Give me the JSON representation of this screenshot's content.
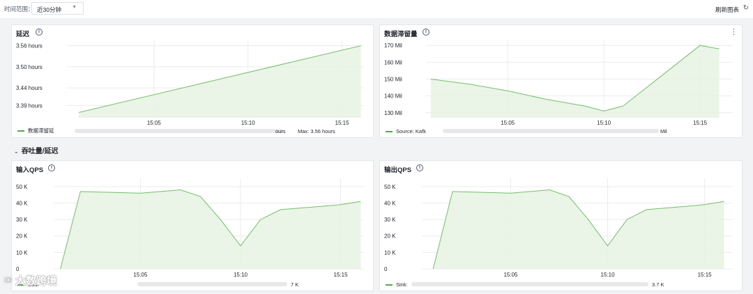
{
  "toolbar": {
    "time_range_label": "时间范围：",
    "time_range_value": "近30分钟",
    "refresh_label": "刷新图表",
    "refresh_icon": "refresh-icon"
  },
  "section": {
    "title": "吞吐量/延迟"
  },
  "logo": {
    "text": "大数跨境"
  },
  "colors": {
    "series": "#73bf69",
    "area": "#e6f2e3"
  },
  "panels": {
    "latency": {
      "title": "延迟",
      "legend_name": "数据滞留延",
      "legend_extra": "Max: 3.56 hours",
      "legend_extra2": "ours"
    },
    "backlog": {
      "title": "数据滞留量",
      "legend_name": "Source: Kafk",
      "legend_extra": "Mil"
    },
    "input_qps": {
      "title": "输入QPS",
      "legend_name": "Sour",
      "legend_extra": "7 K"
    },
    "output_qps": {
      "title": "输出QPS",
      "legend_name": "Sink:",
      "legend_extra": "3.7 K"
    }
  },
  "chart_data": [
    {
      "type": "area",
      "title": "延迟",
      "x_ticks": [
        "15:05",
        "15:10",
        "15:15"
      ],
      "y_ticks": [
        "3.39 hours",
        "3.44 hours",
        "3.50 hours",
        "3.56 hours"
      ],
      "x": [
        "15:01",
        "15:16"
      ],
      "series": [
        {
          "name": "数据滞留延",
          "values": [
            3.37,
            3.56
          ]
        }
      ]
    },
    {
      "type": "area",
      "title": "数据滞留量",
      "x_ticks": [
        "15:05",
        "15:10",
        "15:15"
      ],
      "y_ticks": [
        "130 Mil",
        "140 Mil",
        "150 Mil",
        "160 Mil",
        "170 Mil"
      ],
      "x": [
        "15:01",
        "15:03",
        "15:05",
        "15:07",
        "15:09",
        "15:10",
        "15:11",
        "15:13",
        "15:15",
        "15:16"
      ],
      "series": [
        {
          "name": "Source: Kafk",
          "values": [
            150,
            147,
            143,
            138,
            134,
            131,
            134,
            152,
            170,
            168
          ]
        }
      ]
    },
    {
      "type": "area",
      "title": "输入QPS",
      "x_ticks": [
        "15:05",
        "15:10",
        "15:15"
      ],
      "y_ticks": [
        "0",
        "10 K",
        "20 K",
        "30 K",
        "40 K",
        "50 K"
      ],
      "x": [
        "15:01",
        "15:02",
        "15:05",
        "15:07",
        "15:08",
        "15:09",
        "15:10",
        "15:11",
        "15:12",
        "15:14",
        "15:15",
        "15:16"
      ],
      "series": [
        {
          "name": "Sour",
          "values": [
            0,
            47,
            46,
            48,
            44,
            30,
            14,
            30,
            36,
            38,
            39,
            41
          ]
        }
      ]
    },
    {
      "type": "area",
      "title": "输出QPS",
      "x_ticks": [
        "15:05",
        "15:10",
        "15:15"
      ],
      "y_ticks": [
        "0",
        "10 K",
        "20 K",
        "30 K",
        "40 K",
        "50 K"
      ],
      "x": [
        "15:01",
        "15:02",
        "15:05",
        "15:07",
        "15:08",
        "15:09",
        "15:10",
        "15:11",
        "15:12",
        "15:14",
        "15:15",
        "15:16"
      ],
      "series": [
        {
          "name": "Sink:",
          "values": [
            0,
            47,
            46,
            48,
            44,
            30,
            14,
            30,
            36,
            38,
            39,
            41
          ]
        }
      ]
    }
  ]
}
